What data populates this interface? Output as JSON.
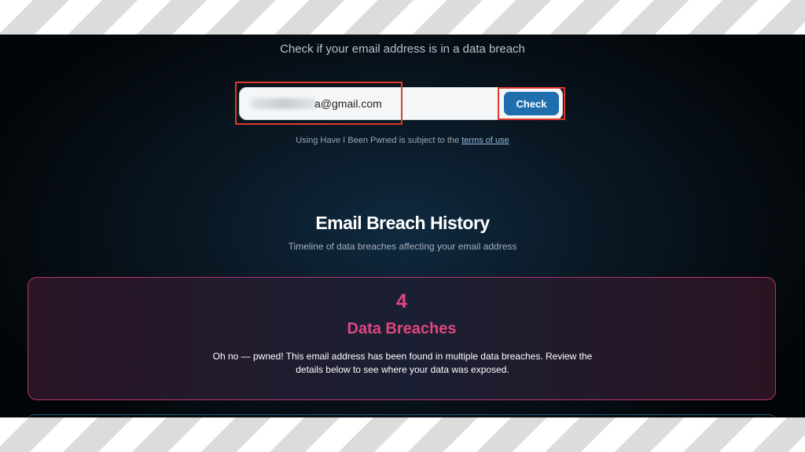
{
  "search": {
    "headline": "Check if your email address is in a data breach",
    "email_visible": "a@gmail.com",
    "button_label": "Check",
    "terms_prefix": "Using Have I Been Pwned is subject to the ",
    "terms_link": "terms of use"
  },
  "history": {
    "title": "Email Breach History",
    "subtitle": "Timeline of data breaches affecting your email address"
  },
  "breaches": {
    "count": "4",
    "label": "Data Breaches",
    "message": "Oh no — pwned! This email address has been found in multiple data breaches. Review the details below to see where your data was exposed."
  },
  "colors": {
    "accent_pink": "#e04680",
    "button_blue": "#1f6fae",
    "highlight_red": "#e0392b"
  }
}
